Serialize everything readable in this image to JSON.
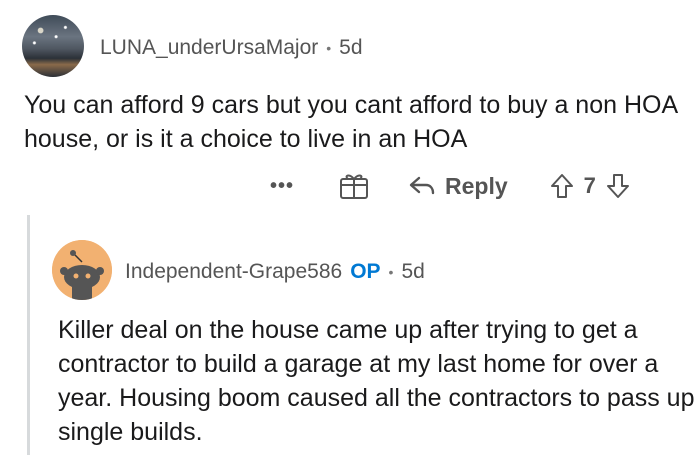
{
  "comment": {
    "username": "LUNA_underUrsaMajor",
    "separator": "•",
    "age": "5d",
    "body": "You can afford 9 cars but you cant afford to buy a non HOA house, or is it a choice to live in an HOA",
    "actions": {
      "more_label": "•••",
      "reply_label": "Reply",
      "vote_count": "7"
    }
  },
  "reply": {
    "username": "Independent-Grape586",
    "op_badge": "OP",
    "separator": "•",
    "age": "5d",
    "body": "Killer deal on the house came up after trying to get a contractor to build a garage at my last home for over a year.  Housing boom caused all the contractors to pass up single builds."
  },
  "colors": {
    "op_badge": "#0079d3",
    "meta_text": "#555555",
    "body_text": "#1a1a1b",
    "avatar_orange": "#f2b171",
    "thread_line": "#d7dadc"
  },
  "icons": [
    "more-icon",
    "award-icon",
    "reply-icon",
    "upvote-icon",
    "downvote-icon",
    "snoo-avatar-icon"
  ]
}
